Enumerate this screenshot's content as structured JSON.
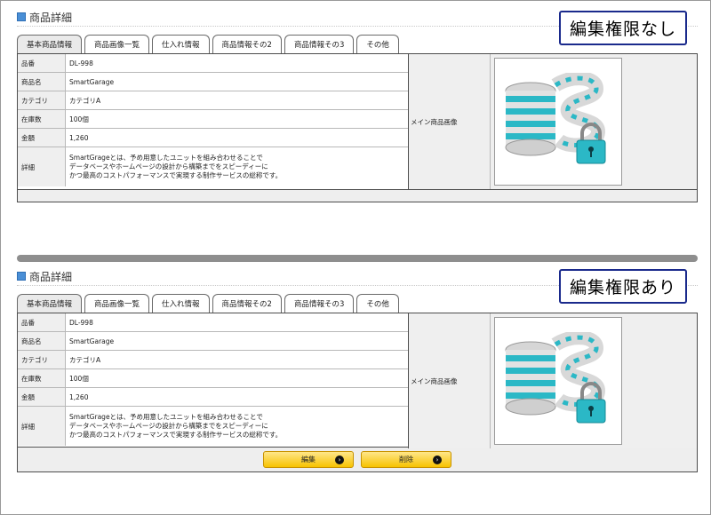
{
  "panel_a": {
    "title": "商品詳細",
    "badge": "編集権限なし",
    "tabs": [
      "基本商品情報",
      "商品画像一覧",
      "仕入れ情報",
      "商品情報その2",
      "商品情報その3",
      "その他"
    ],
    "fields": [
      {
        "label": "品番",
        "value": "DL-998"
      },
      {
        "label": "商品名",
        "value": "SmartGarage"
      },
      {
        "label": "カテゴリ",
        "value": "カテゴリA"
      },
      {
        "label": "在庫数",
        "value": "100個"
      },
      {
        "label": "金額",
        "value": "1,260"
      }
    ],
    "detail": {
      "label": "詳細",
      "lines": [
        "SmartGrageとは、予め用意したユニットを組み合わせることで",
        "データベースやホームページの設計から構築までをスピーディーに",
        "かつ最高のコストパフォーマンスで実現する制作サービスの総称です。"
      ]
    },
    "image_label": "メイン商品画像"
  },
  "panel_b": {
    "title": "商品詳細",
    "badge": "編集権限あり",
    "tabs": [
      "基本商品情報",
      "商品画像一覧",
      "仕入れ情報",
      "商品情報その2",
      "商品情報その3",
      "その他"
    ],
    "fields": [
      {
        "label": "品番",
        "value": "DL-998"
      },
      {
        "label": "商品名",
        "value": "SmartGarage"
      },
      {
        "label": "カテゴリ",
        "value": "カテゴリA"
      },
      {
        "label": "在庫数",
        "value": "100個"
      },
      {
        "label": "金額",
        "value": "1,260"
      }
    ],
    "detail": {
      "label": "詳細",
      "lines": [
        "SmartGrageとは、予め用意したユニットを組み合わせることで",
        "データベースやホームページの設計から構築までをスピーディーに",
        "かつ最高のコストパフォーマンスで実現する制作サービスの総称です。"
      ]
    },
    "image_label": "メイン商品画像",
    "buttons": {
      "edit": "編集",
      "delete": "削除"
    }
  },
  "icons": {
    "title": "square-icon",
    "button": "arrow-circle-right-icon",
    "product": "database-lock-icon"
  },
  "colors": {
    "accent": "#4a8fd6",
    "badge_border": "#1a2a8c",
    "button": "#f7c300",
    "teal": "#2bb8c6"
  }
}
